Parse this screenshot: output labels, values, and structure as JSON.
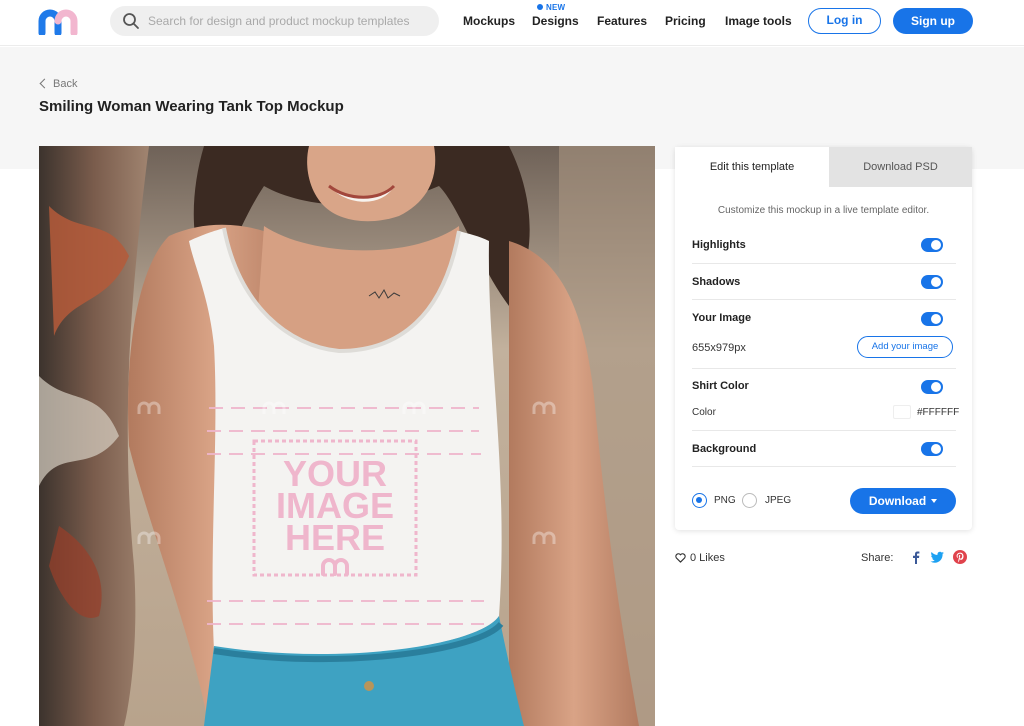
{
  "header": {
    "search_placeholder": "Search for design and product mockup templates",
    "nav": {
      "mockups": "Mockups",
      "designs": "Designs",
      "designs_badge": "NEW",
      "features": "Features",
      "pricing": "Pricing",
      "image_tools": "Image tools"
    },
    "login": "Log in",
    "signup": "Sign up",
    "colors": {
      "accent": "#1874e8",
      "logo_blue": "#1f7ae9",
      "logo_pink": "#f2b6cf"
    }
  },
  "page": {
    "back": "Back",
    "title": "Smiling Woman Wearing Tank Top Mockup"
  },
  "mockup": {
    "placeholder_lines": [
      "YOUR",
      "IMAGE",
      "HERE"
    ],
    "placeholder_color": "#efb6cc"
  },
  "panel": {
    "tabs": {
      "edit": "Edit this template",
      "download_psd": "Download PSD"
    },
    "hint": "Customize this mockup in a live template editor.",
    "highlights": {
      "label": "Highlights",
      "enabled": true
    },
    "shadows": {
      "label": "Shadows",
      "enabled": true
    },
    "your_image": {
      "label": "Your Image",
      "enabled": true,
      "size": "655x979px",
      "add_button": "Add your image"
    },
    "shirt_color": {
      "label": "Shirt Color",
      "enabled": true,
      "color_label": "Color",
      "color_value": "#FFFFFF"
    },
    "background": {
      "label": "Background",
      "enabled": true
    },
    "formats": {
      "png": "PNG",
      "jpeg": "JPEG",
      "selected": "PNG"
    },
    "download": "Download"
  },
  "footer": {
    "likes": "0 Likes",
    "share": "Share:",
    "icons": [
      "facebook-icon",
      "twitter-icon",
      "pinterest-icon"
    ]
  }
}
